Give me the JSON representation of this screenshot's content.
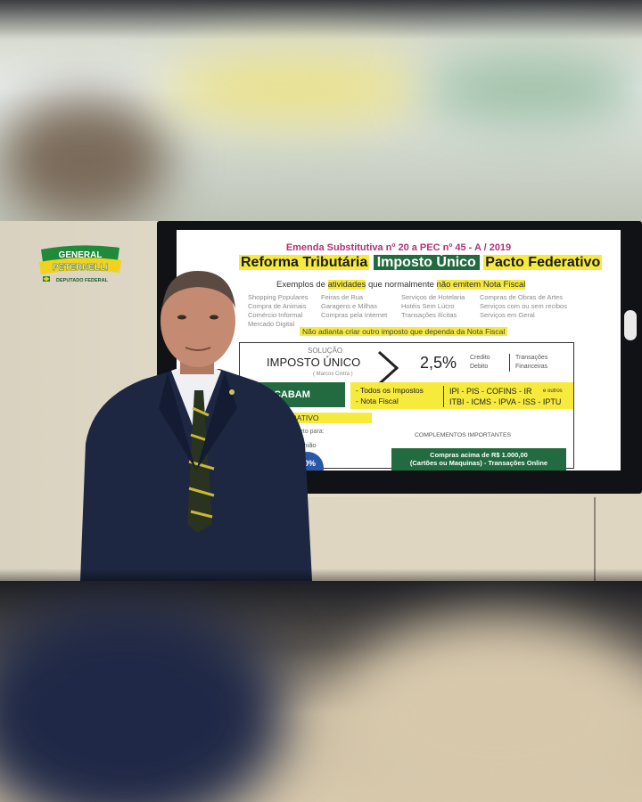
{
  "logo": {
    "line1": "GENERAL",
    "line2": "PETERNELLI",
    "line3": "DEPUTADO FEDERAL"
  },
  "slide": {
    "header": "Emenda Substitutiva nº 20 a PEC nº 45 - A / 2019",
    "title_left": "Reforma Tributária",
    "title_mid": "Imposto Único",
    "title_right": "Pacto Federativo",
    "examples_prefix": "Exemplos de ",
    "examples_hl1": "atividades",
    "examples_mid": " que normalmente ",
    "examples_hl2": "não emitem Nota Fiscal",
    "activities": [
      "Shopping Populares",
      "Feiras de Rua",
      "Serviços de Hotelaria",
      "Compras de Obras de Artes",
      "Compra de Animais",
      "Garagens e Milhas",
      "Hotéis Sem Lúcro",
      "Serviços com ou sem recibos",
      "Comércio Informal",
      "Compras pela Internet",
      "Transações Ilícitas",
      "Serviços em Geral",
      "Mercado Digital"
    ],
    "note": "Não adianta criar outro imposto que dependa da Nota Fiscal",
    "solucao": "SOLUÇÃO",
    "imposto_unico": "IMPOSTO ÚNICO",
    "marcos": "( Marcos Cintra )",
    "rate": "2,5%",
    "credito": "Credito",
    "debito": "Debito",
    "transacoes": "Transações",
    "financeiras": "Financeiras",
    "acabam": "ACABAM",
    "todos_impostos": "- Todos os Impostos",
    "nota_fiscal": "- Nota Fiscal",
    "taxes_line1": "IPI - PIS - COFINS - IR",
    "taxes_line2": "ITBI - ICMS - IPVA - ISS - IPTU",
    "e_outros": "e outros",
    "pacto": "PACTO FEDERATIVO",
    "recursos": "ão - Recursos irão direto para:",
    "uniao": "União",
    "pct_circle": "20%",
    "complementos": "COMPLEMENTOS IMPORTANTES",
    "compras_1": "Compras acima de R$ 1.000,00",
    "compras_2": "(Cartões ou Maquinas) - Transações Online"
  },
  "colors": {
    "slide_green": "#226a3f",
    "slide_yellow": "#f6ea3c",
    "header_magenta": "#b0337a",
    "suit_navy": "#1d2742"
  }
}
